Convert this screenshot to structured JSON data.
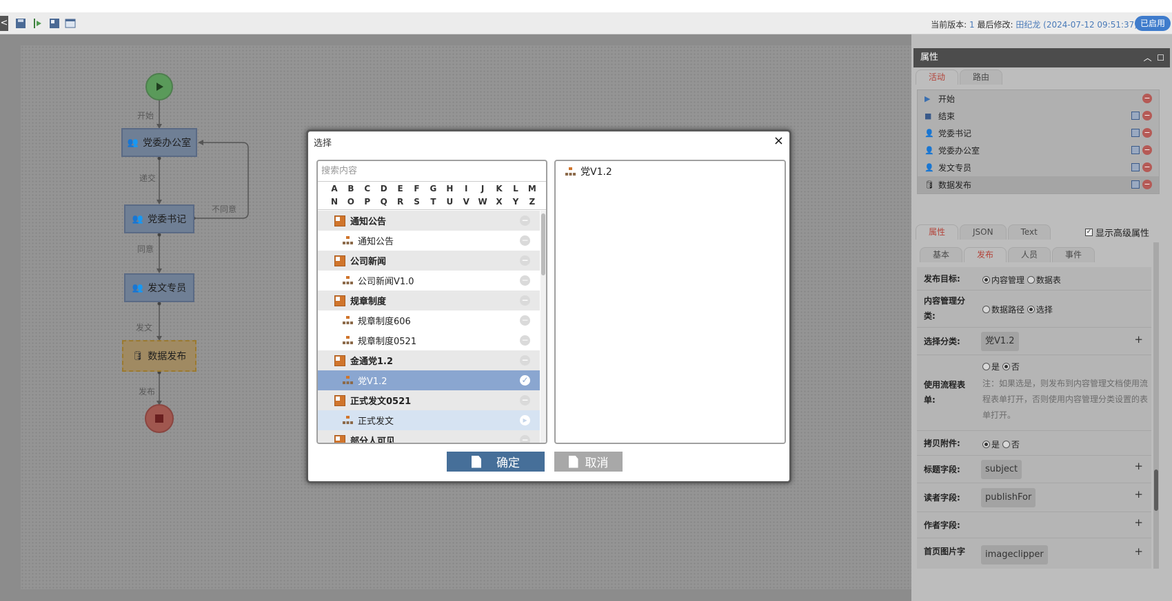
{
  "toolbar": {
    "collapse": "<",
    "version_label": "当前版本: ",
    "version_value": "1",
    "modified_label": " 最后修改: ",
    "modified_by": "田纪龙 (2024-07-12 09:51:37)",
    "status": "已启用"
  },
  "flow": {
    "nodes": [
      "党委办公室",
      "党委书记",
      "发文专员",
      "数据发布"
    ],
    "edge_labels": [
      "开始",
      "递交",
      "不同意",
      "同意",
      "发文",
      "发布"
    ]
  },
  "modal": {
    "title": "选择",
    "close": "×",
    "search_placeholder": "搜索内容",
    "alphabet_row1": [
      "A",
      "B",
      "C",
      "D",
      "E",
      "F",
      "G",
      "H",
      "I",
      "J",
      "K",
      "L",
      "M"
    ],
    "alphabet_row2": [
      "N",
      "O",
      "P",
      "Q",
      "R",
      "S",
      "T",
      "U",
      "V",
      "W",
      "X",
      "Y",
      "Z"
    ],
    "tree": [
      {
        "label": "通知公告",
        "type": "group"
      },
      {
        "label": "通知公告",
        "type": "item"
      },
      {
        "label": "公司新闻",
        "type": "group"
      },
      {
        "label": "公司新闻V1.0",
        "type": "item"
      },
      {
        "label": "规章制度",
        "type": "group"
      },
      {
        "label": "规章制度606",
        "type": "item"
      },
      {
        "label": "规章制度0521",
        "type": "item"
      },
      {
        "label": "金通党1.2",
        "type": "group"
      },
      {
        "label": "党V1.2",
        "type": "item",
        "state": "selected"
      },
      {
        "label": "正式发文0521",
        "type": "group"
      },
      {
        "label": "正式发文",
        "type": "item",
        "state": "hovered"
      },
      {
        "label": "部分人可见",
        "type": "group"
      }
    ],
    "selected_item": "党V1.2",
    "ok_label": "确定",
    "cancel_label": "取消"
  },
  "panel": {
    "title": "属性",
    "tabs_top": [
      "活动",
      "路由"
    ],
    "activities": [
      {
        "label": "开始",
        "icon": "play-icon"
      },
      {
        "label": "结束",
        "icon": "stop-icon"
      },
      {
        "label": "党委书记",
        "icon": "user-icon"
      },
      {
        "label": "党委办公室",
        "icon": "user-icon"
      },
      {
        "label": "发文专员",
        "icon": "user-icon"
      },
      {
        "label": "数据发布",
        "icon": "database-icon"
      }
    ],
    "tabs_mid": [
      "属性",
      "JSON",
      "Text"
    ],
    "show_advanced": "显示高级属性",
    "tabs_sub": [
      "基本",
      "发布",
      "人员",
      "事件"
    ],
    "form": {
      "target_label": "发布目标:",
      "target_opt1": "内容管理",
      "target_opt2": "数据表",
      "category_label": "内容管理分类:",
      "category_opt1": "数据路径",
      "category_opt2": "选择",
      "select_label": "选择分类:",
      "select_value": "党V1.2",
      "flowform_label": "使用流程表单:",
      "yes": "是",
      "no": "否",
      "flowform_note": "注：如果选是，则发布到内容管理文档使用流程表单打开，否则使用内容管理分类设置的表单打开。",
      "copy_label": "拷贝附件:",
      "title_label": "标题字段:",
      "title_value": "subject",
      "reader_label": "读者字段:",
      "reader_value": "publishFor",
      "author_label": "作者字段:",
      "image_label": "首页图片字",
      "image_value": "imageclipper",
      "plus": "+"
    }
  },
  "colors": {
    "accent": "#3f7ccc",
    "ok_button": "#466f99",
    "selected_row": "#8aa6d0",
    "active_tab": "#b3443a"
  }
}
